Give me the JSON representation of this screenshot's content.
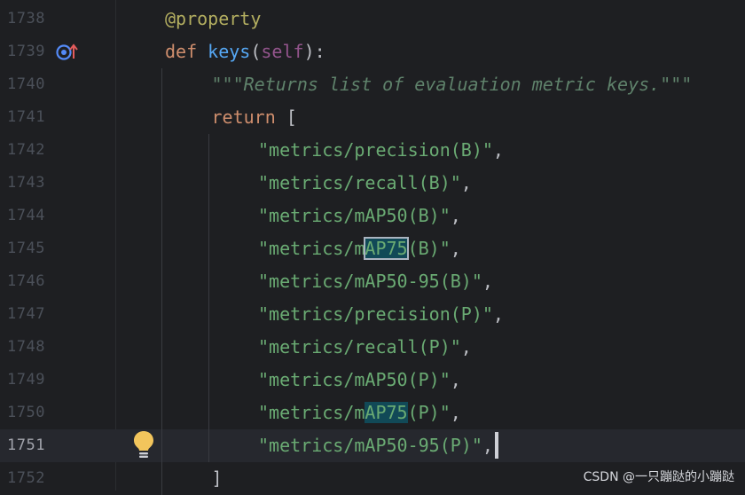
{
  "editor": {
    "lines": [
      {
        "number": "1738",
        "segments": [
          {
            "t": "@property",
            "c": "decorator"
          }
        ]
      },
      {
        "number": "1739",
        "segments": [
          {
            "t": "def ",
            "c": "keyword"
          },
          {
            "t": "keys",
            "c": "func"
          },
          {
            "t": "(",
            "c": "punct"
          },
          {
            "t": "self",
            "c": "self"
          },
          {
            "t": "):",
            "c": "punct"
          }
        ]
      },
      {
        "number": "1740",
        "segments": [
          {
            "t": "\"\"\"Returns list of evaluation metric keys.\"\"\"",
            "c": "doc"
          }
        ]
      },
      {
        "number": "1741",
        "segments": [
          {
            "t": "return ",
            "c": "keyword"
          },
          {
            "t": "[",
            "c": "punct"
          }
        ]
      },
      {
        "number": "1742",
        "segments": [
          {
            "t": "\"metrics/precision(B)\"",
            "c": "string"
          },
          {
            "t": ",",
            "c": "punct"
          }
        ]
      },
      {
        "number": "1743",
        "segments": [
          {
            "t": "\"metrics/recall(B)\"",
            "c": "string"
          },
          {
            "t": ",",
            "c": "punct"
          }
        ]
      },
      {
        "number": "1744",
        "segments": [
          {
            "t": "\"metrics/mAP50(B)\"",
            "c": "string"
          },
          {
            "t": ",",
            "c": "punct"
          }
        ]
      },
      {
        "number": "1745",
        "segments": [
          {
            "t": "\"metrics/m",
            "c": "string"
          },
          {
            "t": "AP75",
            "c": "string",
            "hl": "current"
          },
          {
            "t": "(B)\"",
            "c": "string"
          },
          {
            "t": ",",
            "c": "punct"
          }
        ]
      },
      {
        "number": "1746",
        "segments": [
          {
            "t": "\"metrics/mAP50-95(B)\"",
            "c": "string"
          },
          {
            "t": ",",
            "c": "punct"
          }
        ]
      },
      {
        "number": "1747",
        "segments": [
          {
            "t": "\"metrics/precision(P)\"",
            "c": "string"
          },
          {
            "t": ",",
            "c": "punct"
          }
        ]
      },
      {
        "number": "1748",
        "segments": [
          {
            "t": "\"metrics/recall(P)\"",
            "c": "string"
          },
          {
            "t": ",",
            "c": "punct"
          }
        ]
      },
      {
        "number": "1749",
        "segments": [
          {
            "t": "\"metrics/mAP50(P)\"",
            "c": "string"
          },
          {
            "t": ",",
            "c": "punct"
          }
        ]
      },
      {
        "number": "1750",
        "segments": [
          {
            "t": "\"metrics/m",
            "c": "string"
          },
          {
            "t": "AP75",
            "c": "string",
            "hl": "match"
          },
          {
            "t": "(P)\"",
            "c": "string"
          },
          {
            "t": ",",
            "c": "punct"
          }
        ]
      },
      {
        "number": "1751",
        "current": true,
        "segments": [
          {
            "t": "\"metrics/mAP50-95(P)\"",
            "c": "string"
          },
          {
            "t": ",",
            "c": "punct"
          }
        ]
      },
      {
        "number": "1752",
        "segments": [
          {
            "t": "]",
            "c": "punct"
          }
        ]
      }
    ],
    "indent_levels": [
      1,
      1,
      2,
      2,
      3,
      3,
      3,
      3,
      3,
      3,
      3,
      3,
      3,
      3,
      2
    ],
    "gutter_icons": {
      "line_1739": "override-method-icon",
      "line_1751": "lightbulb-intention-icon"
    }
  },
  "watermark": {
    "text": "CSDN @一只蹦跶的小蹦跶"
  },
  "colors": {
    "background": "#1e1f22",
    "current_line": "#26282e",
    "decorator": "#b3ae60",
    "keyword": "#cf8e6d",
    "function": "#56a8f5",
    "self": "#94558d",
    "docstring": "#5f826b",
    "string": "#6aab73",
    "search_match": "#114957"
  }
}
